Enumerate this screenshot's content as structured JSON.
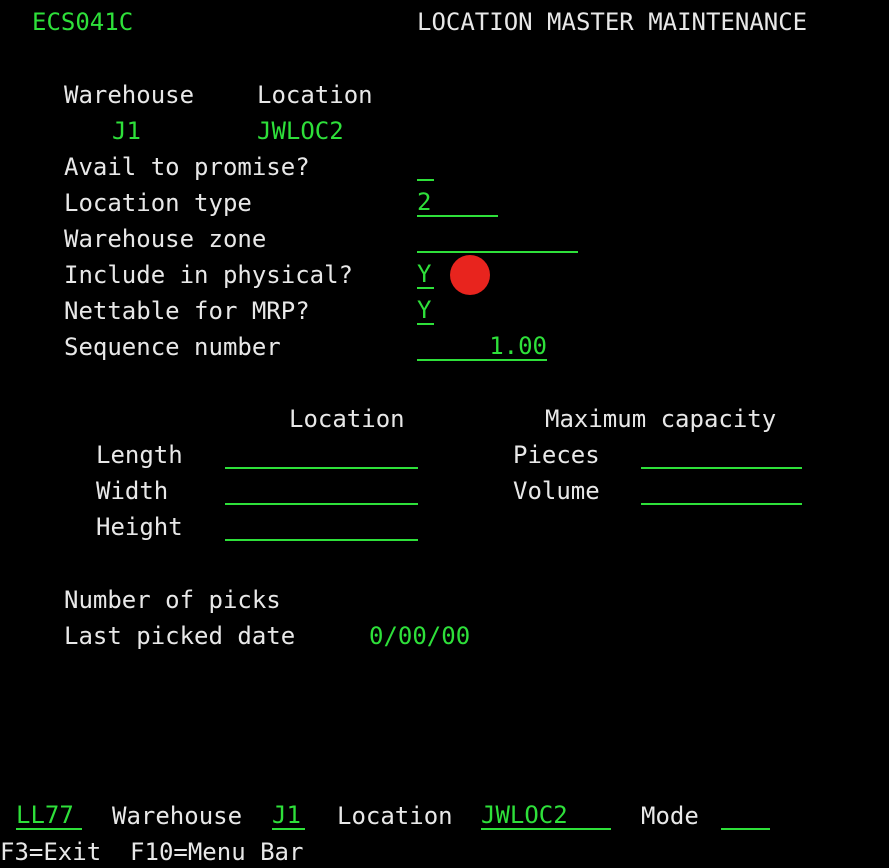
{
  "header": {
    "program_id": "ECS041C",
    "title": "LOCATION MASTER MAINTENANCE"
  },
  "key": {
    "warehouse_label": "Warehouse",
    "location_label": "Location",
    "warehouse_value": "J1",
    "location_value": "JWLOC2"
  },
  "form": {
    "avail_to_promise_label": "Avail to promise?",
    "avail_to_promise_value": "",
    "location_type_label": "Location type",
    "location_type_value": "2",
    "warehouse_zone_label": "Warehouse zone",
    "warehouse_zone_value": "",
    "include_physical_label": "Include in physical?",
    "include_physical_value": "Y",
    "nettable_mrp_label": "Nettable for MRP?",
    "nettable_mrp_value": "Y",
    "sequence_number_label": "Sequence number",
    "sequence_number_value": "1.00"
  },
  "dimensions": {
    "location_header": "Location",
    "capacity_header": "Maximum capacity",
    "length_label": "Length",
    "length_value": "",
    "width_label": "Width",
    "width_value": "",
    "height_label": "Height",
    "height_value": "",
    "pieces_label": "Pieces",
    "pieces_value": "",
    "volume_label": "Volume",
    "volume_value": ""
  },
  "picks": {
    "number_of_picks_label": "Number of picks",
    "last_picked_date_label": "Last picked date",
    "last_picked_date_value": "0/00/00"
  },
  "footer": {
    "screen_code": "LL77",
    "warehouse_label": "Warehouse",
    "warehouse_value": "J1",
    "location_label": "Location",
    "location_value": "JWLOC2",
    "mode_label": "Mode",
    "mode_value": "",
    "function_keys": "F3=Exit  F10=Menu Bar"
  },
  "colors": {
    "background": "#000000",
    "field_green": "#2ee03a",
    "text_white": "#e8e8e8",
    "cursor_red": "#e8241e"
  }
}
